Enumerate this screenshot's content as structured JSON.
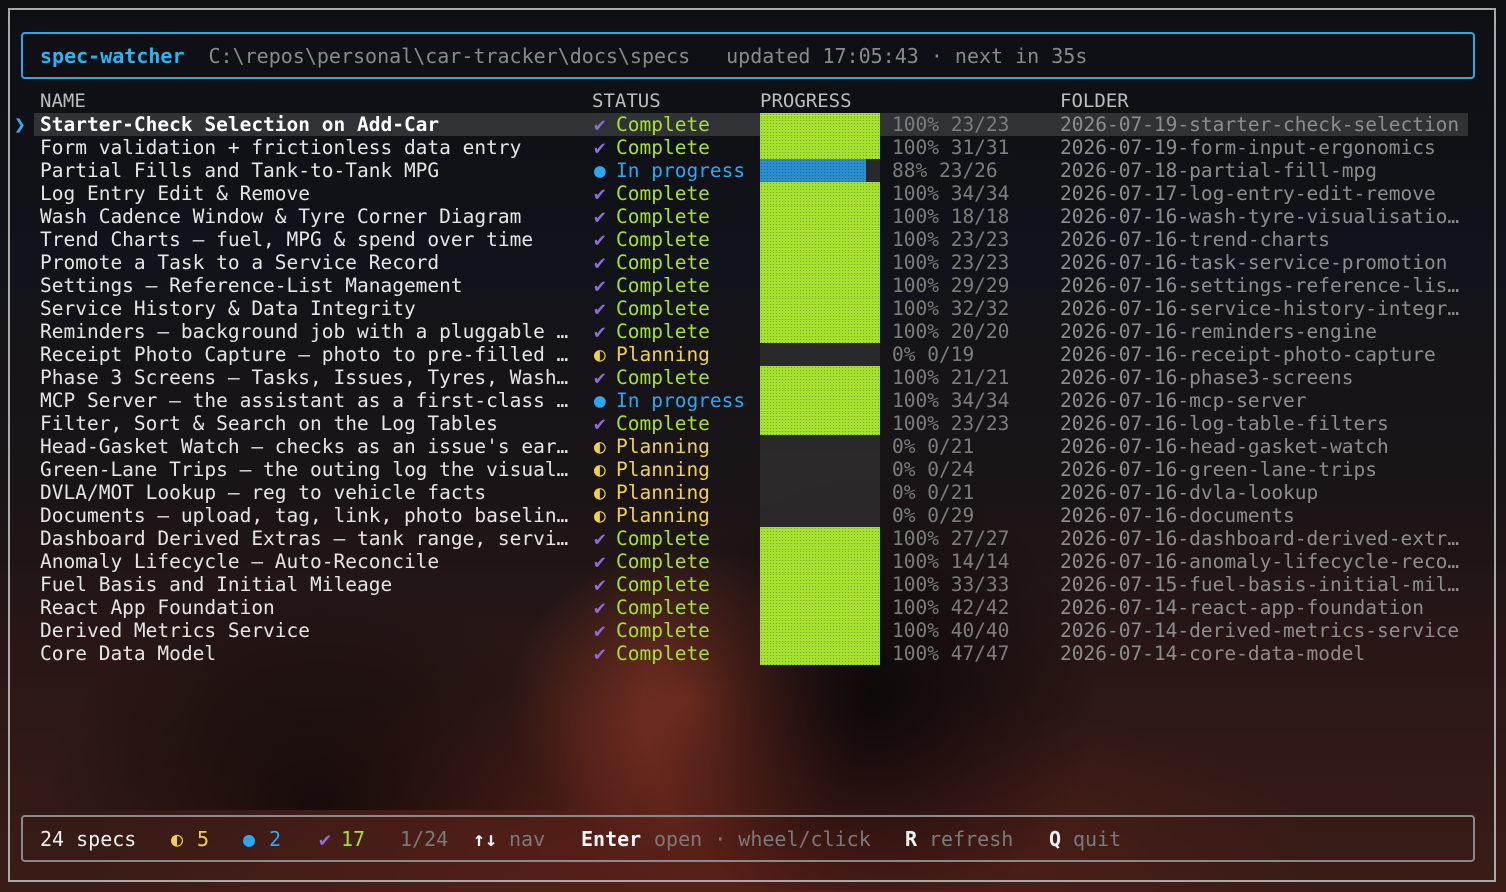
{
  "header": {
    "app_name": "spec-watcher",
    "path": "C:\\repos\\personal\\car-tracker\\docs\\specs",
    "updated": "updated 17:05:43 · next in 35s"
  },
  "columns": {
    "name": "NAME",
    "status": "STATUS",
    "progress": "PROGRESS",
    "folder": "FOLDER"
  },
  "cursor_glyph": "❯",
  "status_glyphs": {
    "complete": "✔",
    "progress": "●",
    "planning": "◐"
  },
  "specs": [
    {
      "name": "Starter-Check Selection on Add-Car",
      "status": "complete",
      "status_label": "Complete",
      "done": 23,
      "total": 23,
      "pct_text": "100% 23/23",
      "folder": "2026-07-19-starter-check-selection",
      "selected": true
    },
    {
      "name": "Form validation + frictionless data entry",
      "status": "complete",
      "status_label": "Complete",
      "done": 31,
      "total": 31,
      "pct_text": "100% 31/31",
      "folder": "2026-07-19-form-input-ergonomics"
    },
    {
      "name": "Partial Fills and Tank-to-Tank MPG",
      "status": "progress",
      "status_label": "In progress",
      "done": 23,
      "total": 26,
      "pct_text": "88% 23/26",
      "folder": "2026-07-18-partial-fill-mpg"
    },
    {
      "name": "Log Entry Edit & Remove",
      "status": "complete",
      "status_label": "Complete",
      "done": 34,
      "total": 34,
      "pct_text": "100% 34/34",
      "folder": "2026-07-17-log-entry-edit-remove"
    },
    {
      "name": "Wash Cadence Window & Tyre Corner Diagram",
      "status": "complete",
      "status_label": "Complete",
      "done": 18,
      "total": 18,
      "pct_text": "100% 18/18",
      "folder": "2026-07-16-wash-tyre-visualisatio…"
    },
    {
      "name": "Trend Charts — fuel, MPG & spend over time",
      "status": "complete",
      "status_label": "Complete",
      "done": 23,
      "total": 23,
      "pct_text": "100% 23/23",
      "folder": "2026-07-16-trend-charts"
    },
    {
      "name": "Promote a Task to a Service Record",
      "status": "complete",
      "status_label": "Complete",
      "done": 23,
      "total": 23,
      "pct_text": "100% 23/23",
      "folder": "2026-07-16-task-service-promotion"
    },
    {
      "name": "Settings — Reference-List Management",
      "status": "complete",
      "status_label": "Complete",
      "done": 29,
      "total": 29,
      "pct_text": "100% 29/29",
      "folder": "2026-07-16-settings-reference-lis…"
    },
    {
      "name": "Service History & Data Integrity",
      "status": "complete",
      "status_label": "Complete",
      "done": 32,
      "total": 32,
      "pct_text": "100% 32/32",
      "folder": "2026-07-16-service-history-integr…"
    },
    {
      "name": "Reminders — background job with a pluggable …",
      "status": "complete",
      "status_label": "Complete",
      "done": 20,
      "total": 20,
      "pct_text": "100% 20/20",
      "folder": "2026-07-16-reminders-engine"
    },
    {
      "name": "Receipt Photo Capture — photo to pre-filled …",
      "status": "planning",
      "status_label": "Planning",
      "done": 0,
      "total": 19,
      "pct_text": "0% 0/19",
      "folder": "2026-07-16-receipt-photo-capture"
    },
    {
      "name": "Phase 3 Screens — Tasks, Issues, Tyres, Wash…",
      "status": "complete",
      "status_label": "Complete",
      "done": 21,
      "total": 21,
      "pct_text": "100% 21/21",
      "folder": "2026-07-16-phase3-screens"
    },
    {
      "name": "MCP Server — the assistant as a first-class …",
      "status": "progress",
      "status_label": "In progress",
      "done": 34,
      "total": 34,
      "pct_text": "100% 34/34",
      "folder": "2026-07-16-mcp-server"
    },
    {
      "name": "Filter, Sort & Search on the Log Tables",
      "status": "complete",
      "status_label": "Complete",
      "done": 23,
      "total": 23,
      "pct_text": "100% 23/23",
      "folder": "2026-07-16-log-table-filters"
    },
    {
      "name": "Head-Gasket Watch — checks as an issue's ear…",
      "status": "planning",
      "status_label": "Planning",
      "done": 0,
      "total": 21,
      "pct_text": "0% 0/21",
      "folder": "2026-07-16-head-gasket-watch"
    },
    {
      "name": "Green-Lane Trips — the outing log the visual…",
      "status": "planning",
      "status_label": "Planning",
      "done": 0,
      "total": 24,
      "pct_text": "0% 0/24",
      "folder": "2026-07-16-green-lane-trips"
    },
    {
      "name": "DVLA/MOT Lookup — reg to vehicle facts",
      "status": "planning",
      "status_label": "Planning",
      "done": 0,
      "total": 21,
      "pct_text": "0% 0/21",
      "folder": "2026-07-16-dvla-lookup"
    },
    {
      "name": "Documents — upload, tag, link, photo baselin…",
      "status": "planning",
      "status_label": "Planning",
      "done": 0,
      "total": 29,
      "pct_text": "0% 0/29",
      "folder": "2026-07-16-documents"
    },
    {
      "name": "Dashboard Derived Extras — tank range, servi…",
      "status": "complete",
      "status_label": "Complete",
      "done": 27,
      "total": 27,
      "pct_text": "100% 27/27",
      "folder": "2026-07-16-dashboard-derived-extr…"
    },
    {
      "name": "Anomaly Lifecycle — Auto-Reconcile",
      "status": "complete",
      "status_label": "Complete",
      "done": 14,
      "total": 14,
      "pct_text": "100% 14/14",
      "folder": "2026-07-16-anomaly-lifecycle-reco…"
    },
    {
      "name": "Fuel Basis and Initial Mileage",
      "status": "complete",
      "status_label": "Complete",
      "done": 33,
      "total": 33,
      "pct_text": "100% 33/33",
      "folder": "2026-07-15-fuel-basis-initial-mil…"
    },
    {
      "name": "React App Foundation",
      "status": "complete",
      "status_label": "Complete",
      "done": 42,
      "total": 42,
      "pct_text": "100% 42/42",
      "folder": "2026-07-14-react-app-foundation"
    },
    {
      "name": "Derived Metrics Service",
      "status": "complete",
      "status_label": "Complete",
      "done": 40,
      "total": 40,
      "pct_text": "100% 40/40",
      "folder": "2026-07-14-derived-metrics-service"
    },
    {
      "name": "Core Data Model",
      "status": "complete",
      "status_label": "Complete",
      "done": 47,
      "total": 47,
      "pct_text": "100% 47/47",
      "folder": "2026-07-14-core-data-model"
    }
  ],
  "footer": {
    "count": "24 specs",
    "planning_glyph": "◐",
    "planning_count": "5",
    "progress_glyph": "●",
    "progress_count": "2",
    "complete_glyph": "✔",
    "complete_count": "17",
    "position": "1/24",
    "nav_key": "↑↓",
    "nav_label": "nav",
    "enter_key": "Enter",
    "enter_label": "open · wheel/click",
    "refresh_key": "R",
    "refresh_label": "refresh",
    "quit_key": "Q",
    "quit_label": "quit"
  },
  "colors": {
    "accent": "#2cb3f2",
    "complete": "#a6e22e",
    "in_progress": "#2ca8f2",
    "planning": "#f0d24a",
    "check": "#8e6bdc"
  }
}
